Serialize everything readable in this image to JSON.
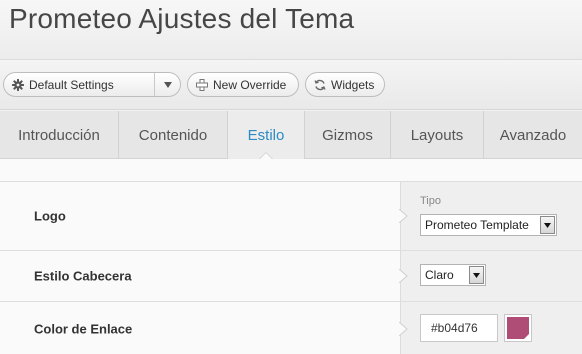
{
  "header": {
    "title": "Prometeo Ajustes del Tema"
  },
  "toolbar": {
    "settings_label": "Default Settings",
    "override_label": "New Override",
    "widgets_label": "Widgets"
  },
  "tabs": [
    {
      "label": "Introducción",
      "active": false
    },
    {
      "label": "Contenido",
      "active": false
    },
    {
      "label": "Estilo",
      "active": true
    },
    {
      "label": "Gizmos",
      "active": false
    },
    {
      "label": "Layouts",
      "active": false
    },
    {
      "label": "Avanzado",
      "active": false
    }
  ],
  "settings": {
    "logo": {
      "label": "Logo",
      "tipo_label": "Tipo",
      "tipo_value": "Prometeo Template"
    },
    "estilo": {
      "label": "Estilo Cabecera",
      "value": "Claro"
    },
    "color": {
      "label": "Color de Enlace",
      "value": "#b04d76"
    }
  },
  "colors": {
    "accent": "#2a8bc5",
    "link_color": "#b04d76"
  },
  "icons": {
    "settings": "gear-icon",
    "override": "plus-icon",
    "widgets": "refresh-icon",
    "dropdown": "chevron-down-icon",
    "row_pointer": "chevron-right-icon"
  }
}
